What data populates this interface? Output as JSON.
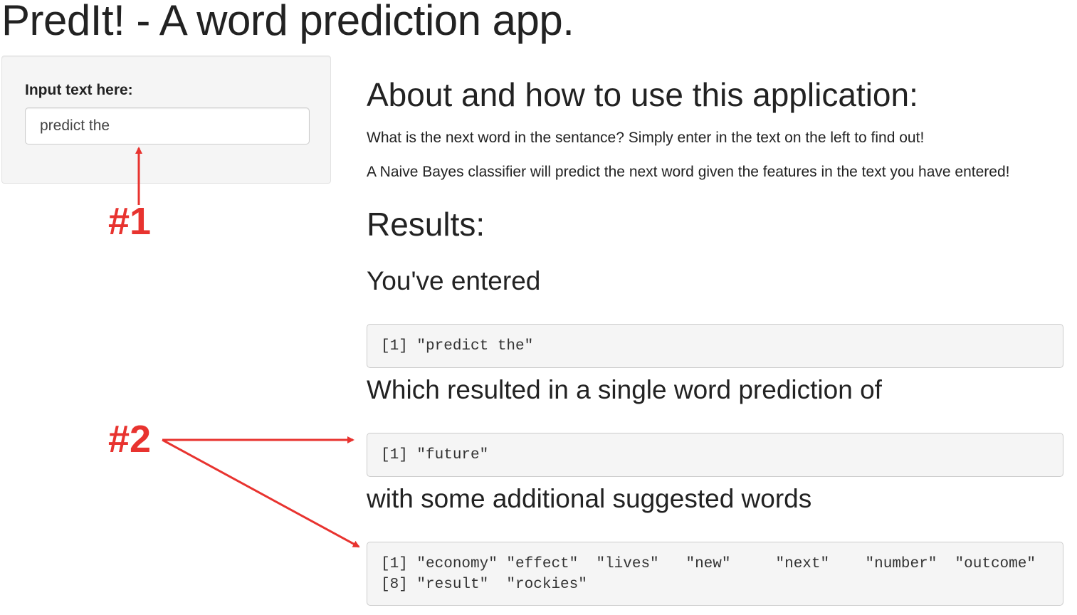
{
  "app": {
    "title": "PredIt! - A word prediction app."
  },
  "sidebar": {
    "input_label": "Input text here:",
    "input_value": "predict the"
  },
  "about": {
    "heading": "About and how to use this application:",
    "paragraph_1": "What is the next word in the sentance? Simply enter in the text on the left to find out!",
    "paragraph_2": "A Naive Bayes classifier will predict the next word given the features in the text you have entered!"
  },
  "results": {
    "heading": "Results:",
    "entered_heading": "You've entered",
    "entered_output": "[1] \"predict the\"",
    "single_heading": "Which resulted in a single word prediction of",
    "single_output": "[1] \"future\"",
    "additional_heading": "with some additional suggested words",
    "additional_output": "[1] \"economy\" \"effect\"  \"lives\"   \"new\"     \"next\"    \"number\"  \"outcome\"\n[8] \"result\"  \"rockies\""
  },
  "annotations": {
    "label_1": "#1",
    "label_2": "#2",
    "color": "#e8332f"
  }
}
